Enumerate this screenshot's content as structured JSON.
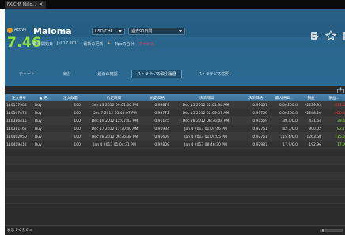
{
  "window": {
    "tab_title": "FX/CHF Malo...",
    "close_glyph": "×"
  },
  "strategy": {
    "status_label": "Active",
    "score": "7.46",
    "name": "Maloma",
    "pair": "USD/CHF",
    "period": "過去90日間",
    "meta": [
      "取引開始日",
      "Jul 17 2011",
      "最新の更新",
      "+",
      "Pipsの合計",
      "マイナス"
    ]
  },
  "colors": {
    "accent_green": "#8ce23a",
    "header_blue": "#2b6a92",
    "loss_red": "#ff3b30",
    "gain_green": "#8bdc34"
  },
  "icons": [
    "play-icon",
    "document-icon",
    "star-icon",
    "export-icon"
  ],
  "tabs": [
    "チャート",
    "統計",
    "過去の確認",
    "ストラテジの取引履歴",
    "ストラテジの説明"
  ],
  "table": {
    "columns": [
      "注文番号",
      "▲ 売...",
      "注文数量",
      "約定時間",
      "約定価格",
      "決済時間",
      "決済価格",
      "最大評価...",
      "損益",
      "損益..."
    ],
    "rows": [
      [
        "110157902",
        "Buy",
        "100",
        "Sep 13 2012 09:01:00 PM",
        "0.93879",
        "Dec 15 2012 02:01:34 AM",
        "0.91667",
        "0.0/-200.0",
        "-2239.93",
        "-221.2"
      ],
      [
        "110367478",
        "Buy",
        "100",
        "Dec 7 2012 10:45:07 PM",
        "0.93772",
        "Dec 15 2012 02:09:07 AM",
        "0.91766",
        "0.0/-200.6",
        "-2248.20",
        "-200.6"
      ],
      [
        "110386415",
        "Buy",
        "100",
        "Dec 19 2012 12:07:43 PM",
        "0.91175",
        "Dec 28 2012 06:36:08 PM",
        "0.91569",
        "39.4/0.0",
        "431.54",
        "39.4"
      ],
      [
        "110381162",
        "Buy",
        "100",
        "Dec 17 2012 11:30:40 AM",
        "0.91934",
        "Jan 4 2013 01:04:46 PM",
        "0.92761",
        "82.7/0.0",
        "900.02",
        "82.7"
      ],
      [
        "110402050",
        "Buy",
        "100",
        "Dec 28 2012 06:36:38 PM",
        "0.91609",
        "Jan 4 2013 01:04:05 PM",
        "0.92761",
        "115.6/0.0",
        "1263.50",
        "115.6"
      ],
      [
        "110409412",
        "Buy",
        "100",
        "Jan 4 2013 01:04:31 PM",
        "0.92808",
        "Jan 4 2013 08:46:30 PM",
        "0.92987",
        "17.9/0.0",
        "192.96",
        "17.9"
      ]
    ]
  },
  "pager": {
    "text": "表示 1-6 計6 ≡"
  }
}
